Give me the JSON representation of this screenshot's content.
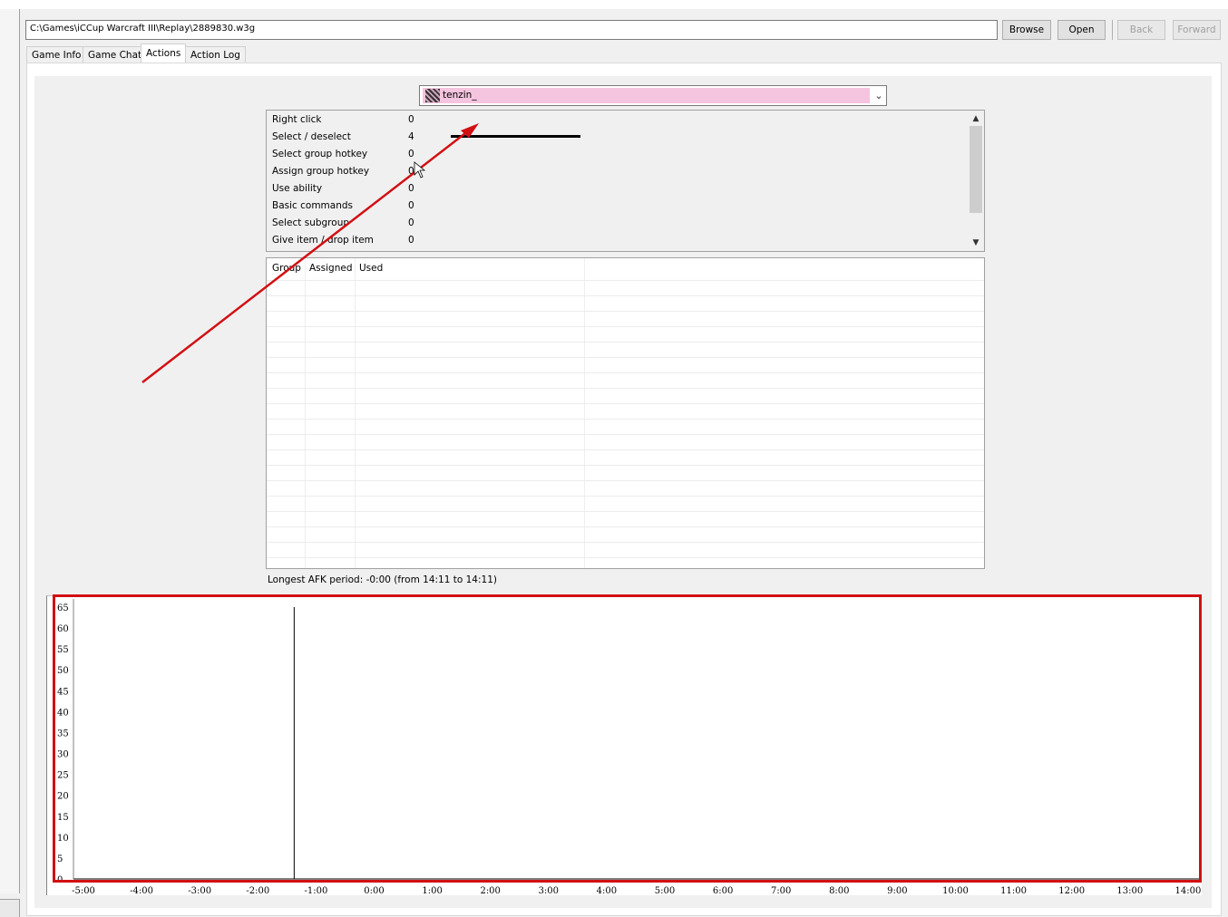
{
  "path": "C:\\Games\\iCCup Warcraft III\\Replay\\2889830.w3g",
  "buttons": {
    "browse": "Browse",
    "open": "Open",
    "back": "Back",
    "forward": "Forward"
  },
  "tabs": [
    {
      "label": "Game Info",
      "active": false
    },
    {
      "label": "Game Chat",
      "active": false
    },
    {
      "label": "Actions",
      "active": true
    },
    {
      "label": "Action Log",
      "active": false
    }
  ],
  "player": {
    "name": "tenzin_",
    "color": "#f5c4de"
  },
  "actions": [
    {
      "label": "Right click",
      "value": "0"
    },
    {
      "label": "Select / deselect",
      "value": "4"
    },
    {
      "label": "Select group hotkey",
      "value": "0"
    },
    {
      "label": "Assign group hotkey",
      "value": "0"
    },
    {
      "label": "Use ability",
      "value": "0"
    },
    {
      "label": "Basic commands",
      "value": "0"
    },
    {
      "label": "Select subgroup",
      "value": "0"
    },
    {
      "label": "Give item / drop item",
      "value": "0"
    }
  ],
  "group_grid": {
    "headers": [
      "Group",
      "Assigned",
      "Used"
    ]
  },
  "afk": "Longest AFK period: -0:00 (from 14:11 to 14:11)",
  "chart_data": {
    "type": "bar",
    "x_ticks": [
      "-5:00",
      "-4:00",
      "-3:00",
      "-2:00",
      "-1:00",
      "0:00",
      "1:00",
      "2:00",
      "3:00",
      "4:00",
      "5:00",
      "6:00",
      "7:00",
      "8:00",
      "9:00",
      "10:00",
      "11:00",
      "12:00",
      "13:00",
      "14:00"
    ],
    "y_ticks": [
      "65",
      "60",
      "55",
      "50",
      "45",
      "40",
      "35",
      "30",
      "25",
      "20",
      "15",
      "10",
      "5",
      "0"
    ],
    "ylim": [
      0,
      65
    ],
    "xlim_minutes": [
      -5,
      14
    ],
    "marker_minute": -1.5,
    "grid": false,
    "colors": {
      "highlight": "#d20f12",
      "bar": "#000000"
    }
  }
}
